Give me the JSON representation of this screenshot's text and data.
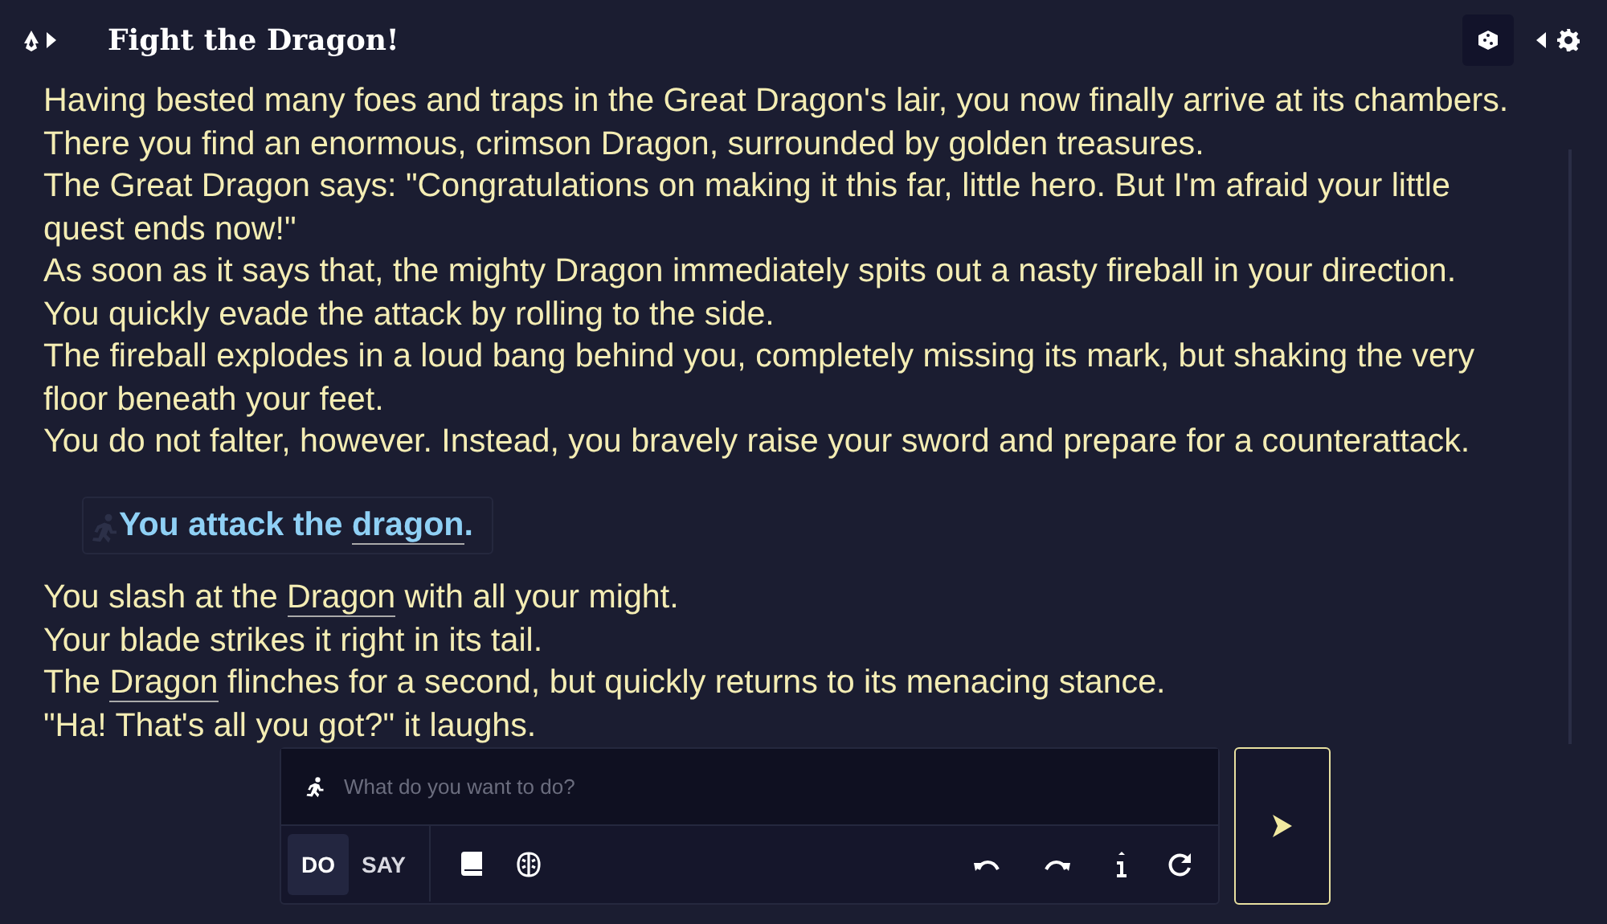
{
  "header": {
    "title": "Fight the Dragon!"
  },
  "story": [
    {
      "kind": "narration",
      "parts": [
        {
          "text": "Having bested many foes and traps in the Great Dragon's lair, you now finally arrive at its chambers."
        }
      ]
    },
    {
      "kind": "narration",
      "parts": [
        {
          "text": "There you find an enormous, crimson Dragon, surrounded by golden treasures."
        }
      ]
    },
    {
      "kind": "narration",
      "parts": [
        {
          "text": "The Great Dragon says: \"Congratulations on making it this far, little hero. But I'm afraid your little quest ends now!\""
        }
      ]
    },
    {
      "kind": "narration",
      "parts": [
        {
          "text": "As soon as it says that, the mighty Dragon immediately spits out a nasty fireball in your direction."
        }
      ]
    },
    {
      "kind": "narration",
      "parts": [
        {
          "text": "You quickly evade the attack by rolling to the side."
        }
      ]
    },
    {
      "kind": "narration",
      "parts": [
        {
          "text": "The fireball explodes in a loud bang behind you, completely missing its mark, but shaking the very floor beneath your feet."
        }
      ]
    },
    {
      "kind": "narration",
      "parts": [
        {
          "text": "You do not falter, however. Instead, you bravely raise your sword and prepare for a counterattack."
        }
      ]
    },
    {
      "kind": "action",
      "parts": [
        {
          "text": "You attack the "
        },
        {
          "text": "dragon",
          "link": true
        },
        {
          "text": "."
        }
      ]
    },
    {
      "kind": "narration",
      "parts": [
        {
          "text": "You slash at the "
        },
        {
          "text": "Dragon",
          "link": true
        },
        {
          "text": " with all your might."
        }
      ]
    },
    {
      "kind": "narration",
      "parts": [
        {
          "text": "Your blade strikes it right in its tail."
        }
      ]
    },
    {
      "kind": "narration",
      "parts": [
        {
          "text": "The "
        },
        {
          "text": "Dragon",
          "link": true
        },
        {
          "text": " flinches for a second, but quickly returns to its menacing stance."
        }
      ]
    },
    {
      "kind": "narration",
      "parts": [
        {
          "text": "\"Ha! That's all you got?\" it laughs."
        }
      ]
    }
  ],
  "input": {
    "placeholder": "What do you want to do?"
  },
  "modes": [
    {
      "label": "DO",
      "selected": true
    },
    {
      "label": "SAY",
      "selected": false
    }
  ]
}
